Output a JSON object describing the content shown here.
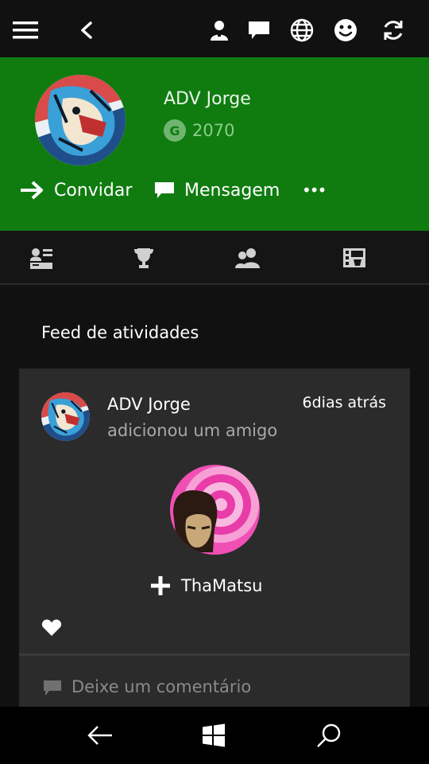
{
  "topbar": {
    "icons": [
      "hamburger-menu-icon",
      "back-chevron-icon",
      "friends-icon",
      "messages-icon",
      "globe-icon",
      "smiley-icon",
      "refresh-icon"
    ]
  },
  "profile": {
    "gamertag": "ADV Jorge",
    "gamerscore_badge": "G",
    "gamerscore": "2070",
    "actions": {
      "invite_label": "Convidar",
      "message_label": "Mensagem",
      "more_label": "•••"
    }
  },
  "tabs": [
    {
      "icon": "profile-card-icon"
    },
    {
      "icon": "trophy-icon"
    },
    {
      "icon": "friends-group-icon"
    },
    {
      "icon": "game-clips-icon"
    }
  ],
  "feed": {
    "title": "Feed de atividades",
    "items": [
      {
        "author": "ADV Jorge",
        "time": "6dias atrás",
        "activity": "adicionou um amigo",
        "friend_name": "ThaMatsu",
        "comment_placeholder": "Deixe um comentário"
      }
    ]
  },
  "colors": {
    "accent": "#107c10",
    "background": "#111111",
    "card": "#2b2b2b"
  }
}
